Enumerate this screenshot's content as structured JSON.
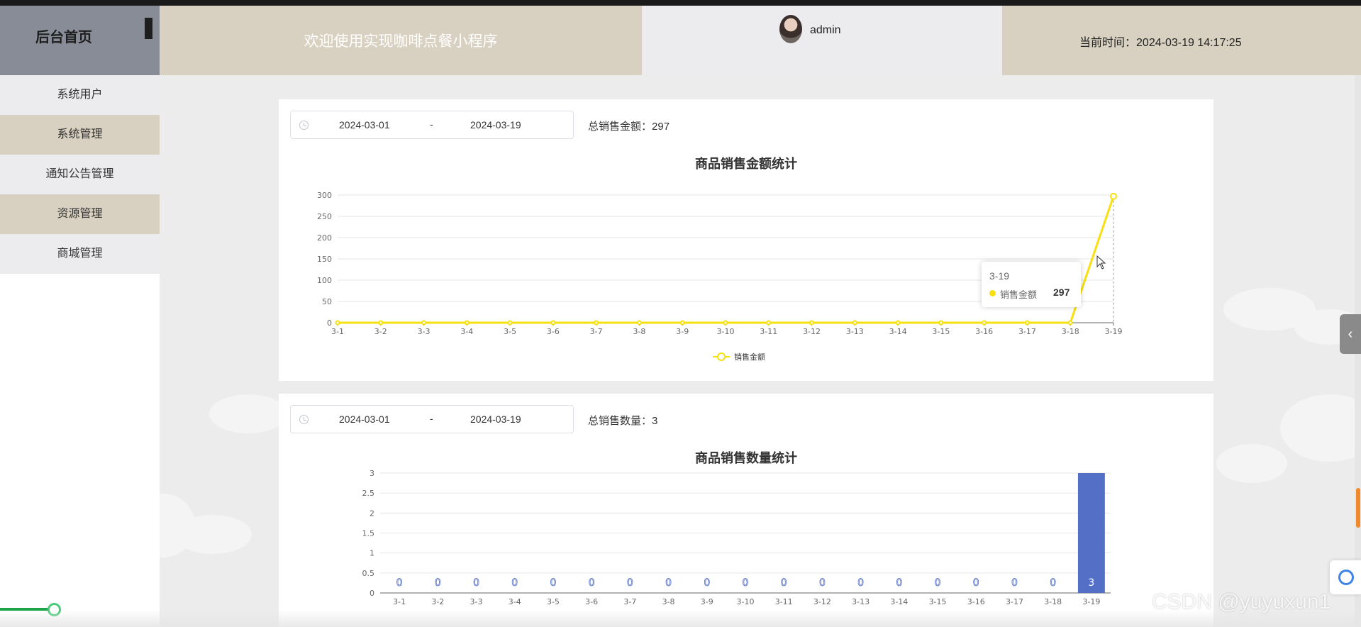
{
  "header": {
    "home_title": "后台首页",
    "welcome": "欢迎使用实现咖啡点餐小程序",
    "username": "admin",
    "time_label": "当前时间：",
    "time_value": "2024-03-19 14:17:25"
  },
  "sidebar": {
    "items": [
      {
        "label": "系统用户"
      },
      {
        "label": "系统管理"
      },
      {
        "label": "通知公告管理"
      },
      {
        "label": "资源管理"
      },
      {
        "label": "商城管理"
      }
    ]
  },
  "card1": {
    "date_start": "2024-03-01",
    "date_sep": "-",
    "date_end": "2024-03-19",
    "total_label": "总销售金额：",
    "total_value": "297"
  },
  "card2": {
    "date_start": "2024-03-01",
    "date_sep": "-",
    "date_end": "2024-03-19",
    "total_label": "总销售数量：",
    "total_value": "3"
  },
  "tooltip": {
    "date": "3-19",
    "series": "销售金额",
    "value": "297"
  },
  "watermark": "CSDN @yuyuxun1",
  "colors": {
    "line": "#f7e00e",
    "bar": "#5470c6",
    "header_beige": "#d8d0c0",
    "header_grey": "#888c96"
  },
  "chart_data": [
    {
      "type": "line",
      "title": "商品销售金额统计",
      "categories": [
        "3-1",
        "3-2",
        "3-3",
        "3-4",
        "3-5",
        "3-6",
        "3-7",
        "3-8",
        "3-9",
        "3-10",
        "3-11",
        "3-12",
        "3-13",
        "3-14",
        "3-15",
        "3-16",
        "3-17",
        "3-18",
        "3-19"
      ],
      "series": [
        {
          "name": "销售金额",
          "values": [
            0,
            0,
            0,
            0,
            0,
            0,
            0,
            0,
            0,
            0,
            0,
            0,
            0,
            0,
            0,
            0,
            0,
            0,
            297
          ]
        }
      ],
      "yticks": [
        "0",
        "50",
        "100",
        "150",
        "200",
        "250",
        "300"
      ],
      "ylim": [
        0,
        300
      ],
      "legend": "bottom-center",
      "grid": true
    },
    {
      "type": "bar",
      "title": "商品销售数量统计",
      "categories": [
        "3-1",
        "3-2",
        "3-3",
        "3-4",
        "3-5",
        "3-6",
        "3-7",
        "3-8",
        "3-9",
        "3-10",
        "3-11",
        "3-12",
        "3-13",
        "3-14",
        "3-15",
        "3-16",
        "3-17",
        "3-18",
        "3-19"
      ],
      "values": [
        0,
        0,
        0,
        0,
        0,
        0,
        0,
        0,
        0,
        0,
        0,
        0,
        0,
        0,
        0,
        0,
        0,
        0,
        3
      ],
      "yticks": [
        "0",
        "0.5",
        "1",
        "1.5",
        "2",
        "2.5",
        "3"
      ],
      "ylim": [
        0,
        3
      ],
      "data_labels": true,
      "grid": true
    }
  ]
}
